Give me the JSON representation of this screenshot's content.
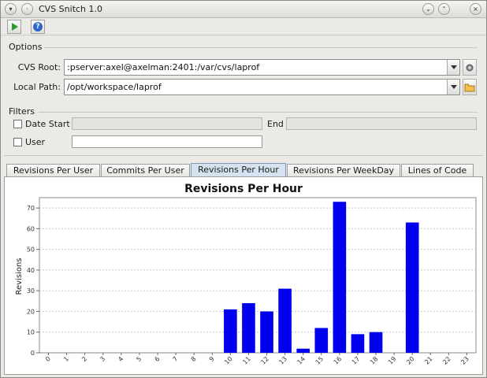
{
  "window": {
    "title": "CVS Snitch 1.0",
    "controls": [
      "minimize",
      "maximize",
      "close"
    ]
  },
  "toolbar": {
    "buttons": [
      {
        "name": "run",
        "icon": "play-icon"
      },
      {
        "name": "help",
        "icon": "help-icon"
      }
    ]
  },
  "options": {
    "title": "Options",
    "cvs_root_label": "CVS Root:",
    "cvs_root_value": ":pserver:axel@axelman:2401:/var/cvs/laprof",
    "local_path_label": "Local Path:",
    "local_path_value": "/opt/workspace/laprof"
  },
  "filters": {
    "title": "Filters",
    "date_start_label": "Date Start",
    "end_label": "End",
    "user_label": "User",
    "date_start_value": "",
    "end_value": "",
    "user_value": ""
  },
  "tabs": [
    {
      "label": "Revisions Per User",
      "active": false
    },
    {
      "label": "Commits Per User",
      "active": false
    },
    {
      "label": "Revisions Per Hour",
      "active": true
    },
    {
      "label": "Revisions Per WeekDay",
      "active": false
    },
    {
      "label": "Lines of Code",
      "active": false
    }
  ],
  "chart_data": {
    "type": "bar",
    "title": "Revisions Per Hour",
    "xlabel": "",
    "ylabel": "Revisions",
    "ylim": [
      0,
      75
    ],
    "yticks": [
      0,
      10,
      20,
      30,
      40,
      50,
      60,
      70
    ],
    "categories": [
      "0",
      "1",
      "2",
      "3",
      "4",
      "5",
      "6",
      "7",
      "8",
      "9",
      "10",
      "11",
      "12",
      "13",
      "14",
      "15",
      "16",
      "17",
      "18",
      "19",
      "20",
      "21",
      "22",
      "23"
    ],
    "values": [
      0,
      0,
      0,
      0,
      0,
      0,
      0,
      0,
      0,
      0,
      21,
      24,
      20,
      31,
      2,
      12,
      73,
      9,
      10,
      0,
      63,
      0,
      0,
      0
    ],
    "bar_color": "#0000ee",
    "grid": true
  },
  "colors": {
    "bar": "#0000ee",
    "active_tab": "#d6e2f0"
  }
}
